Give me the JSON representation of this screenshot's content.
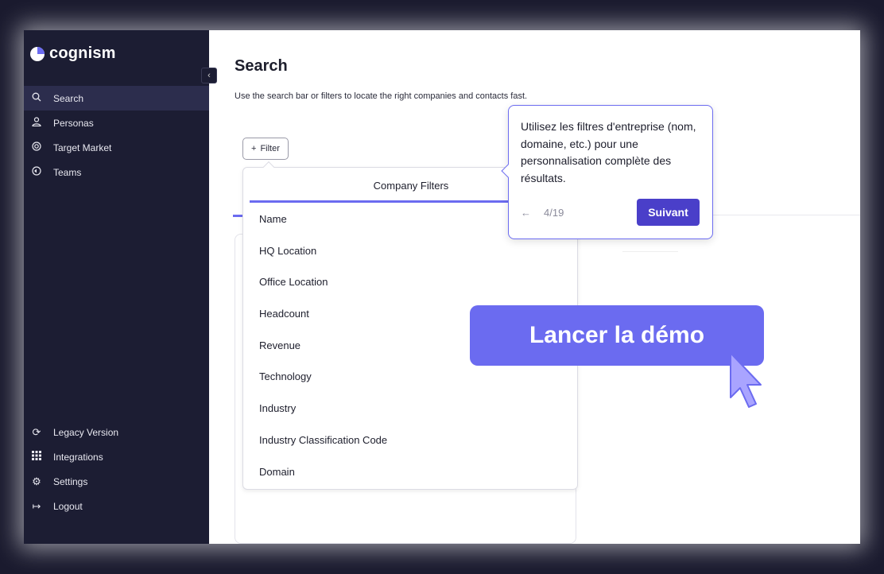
{
  "app": {
    "brand": "cognism"
  },
  "sidebar": {
    "collapse_glyph": "‹",
    "items": [
      {
        "label": "Search",
        "icon": "search-icon",
        "active": true
      },
      {
        "label": "Personas",
        "icon": "user-icon"
      },
      {
        "label": "Target Market",
        "icon": "target-icon"
      },
      {
        "label": "Teams",
        "icon": "teams-icon"
      }
    ],
    "bottom_items": [
      {
        "label": "Legacy Version",
        "icon": "refresh-icon"
      },
      {
        "label": "Integrations",
        "icon": "grid-icon"
      },
      {
        "label": "Settings",
        "icon": "gear-icon"
      },
      {
        "label": "Logout",
        "icon": "logout-icon"
      }
    ]
  },
  "main": {
    "title": "Search",
    "subtitle": "Use the search bar or filters to locate the right companies and contacts fast.",
    "filter_button": {
      "icon": "+",
      "label": "Filter"
    }
  },
  "dropdown": {
    "header": "Company Filters",
    "items": [
      "Name",
      "HQ Location",
      "Office Location",
      "Headcount",
      "Revenue",
      "Technology",
      "Industry",
      "Industry Classification Code",
      "Domain"
    ]
  },
  "tooltip": {
    "text": "Utilisez les filtres d'entreprise (nom, domaine, etc.) pour une personnalisation complète des résultats.",
    "back_glyph": "←",
    "step": "4/19",
    "next_label": "Suivant"
  },
  "cta": {
    "label": "Lancer la démo"
  },
  "colors": {
    "sidebar_bg": "#1c1d33",
    "accent": "#6b6bf0",
    "next_button": "#4a3fc9"
  }
}
